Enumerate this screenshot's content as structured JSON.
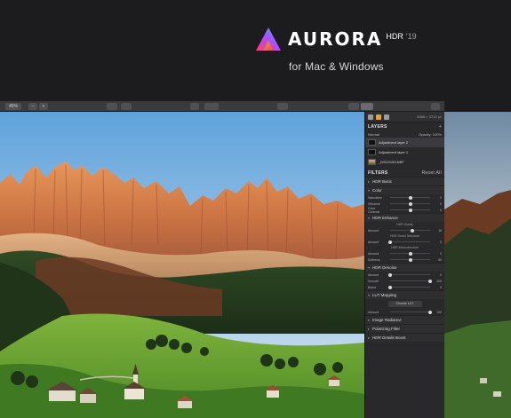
{
  "brand": {
    "name": "AURORA",
    "hdr": "HDR",
    "year": "'19",
    "tagline": "for Mac & Windows"
  },
  "toolbar": {
    "zoom": "45%",
    "zoom_out": "–",
    "zoom_in": "+"
  },
  "panel": {
    "dims": "5568 × 3712 px",
    "layers": {
      "title": "LAYERS",
      "blend_mode": "Normal",
      "opacity_label": "Opacity:",
      "opacity_value": "100%",
      "items": [
        {
          "name": "Adjustment layer 2"
        },
        {
          "name": "Adjustment layer 1"
        },
        {
          "name": "_DSC0153.NEF"
        }
      ]
    },
    "filters": {
      "title": "FILTERS",
      "reset": "Reset All"
    },
    "groups": {
      "hdr_basic": "HDR Basic",
      "color": "Color",
      "hdr_enhance": "HDR Enhance",
      "hdr_denoise": "HDR Denoise",
      "lut_mapping": "LUT Mapping",
      "image_radiance": "Image Radiance",
      "polarizing": "Polarizing Filter",
      "hdr_details_boost": "HDR Details Boost"
    },
    "color_sliders": [
      {
        "label": "Saturation",
        "value": "0",
        "pos": 0.5
      },
      {
        "label": "Vibrance",
        "value": "0",
        "pos": 0.5
      },
      {
        "label": "Color Contrast",
        "value": "0",
        "pos": 0.5
      }
    ],
    "enhance": {
      "clarity_title": "HDR Clarity",
      "clarity": {
        "label": "Amount",
        "value": "16",
        "pos": 0.55
      },
      "smart_title": "HDR Smart Structure",
      "smart": {
        "label": "Amount",
        "value": "0",
        "pos": 0.0
      },
      "micro_title": "HDR Microstructure",
      "micro_amount": {
        "label": "Amount",
        "value": "0",
        "pos": 0.5
      },
      "micro_softness": {
        "label": "Softness",
        "value": "50",
        "pos": 0.5
      }
    },
    "denoise": [
      {
        "label": "Amount",
        "value": "0",
        "pos": 0.0
      },
      {
        "label": "Smooth",
        "value": "100",
        "pos": 1.0
      },
      {
        "label": "Boost",
        "value": "0",
        "pos": 0.0
      }
    ],
    "lut": {
      "button": "Choose LUT",
      "amount": {
        "label": "Amount",
        "value": "100",
        "pos": 1.0
      }
    }
  }
}
